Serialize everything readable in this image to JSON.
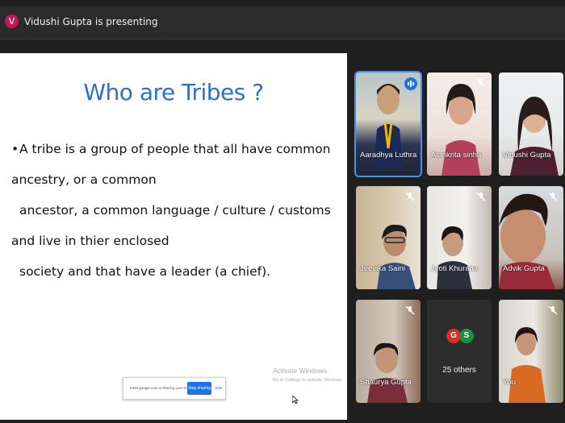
{
  "topbar": {
    "avatar_letter": "V",
    "presenting_text": "Vidushi Gupta is presenting"
  },
  "slide": {
    "title": "Who are Tribes ?",
    "bullet": "•",
    "lines": [
      "A tribe is a group of people that all have common ancestry, or a common",
      "ancestor, a common language / culture / customs and live in thier enclosed",
      "society and that have a leader (a chief)."
    ]
  },
  "share_bar": {
    "message": "meet.google.com is sharing your screen.",
    "stop_label": "Stop sharing",
    "hide_label": "Hide"
  },
  "watermark": {
    "title": "Activate Windows",
    "subtitle": "Go to Settings to activate Windows."
  },
  "participants": [
    {
      "name": "Aaradhya Luthra",
      "state": "speaking"
    },
    {
      "name": "Alankrita sinha",
      "state": "muted"
    },
    {
      "name": "Vidushi Gupta",
      "state": "none"
    },
    {
      "name": "Jeevika Saini",
      "state": "muted"
    },
    {
      "name": "Jyoti Khurana",
      "state": "muted"
    },
    {
      "name": "Advik Gupta",
      "state": "muted"
    },
    {
      "name": "Shaurya Gupta",
      "state": "muted"
    },
    {
      "name": "You",
      "state": "muted"
    }
  ],
  "others": {
    "avatars": [
      {
        "letter": "G",
        "color": "#d93025"
      },
      {
        "letter": "S",
        "color": "#1e8e3e"
      }
    ],
    "label": "25 others"
  },
  "colors": {
    "title_blue": "#2f6fc6",
    "active_outline": "#4a8fe8",
    "stop_button": "#1a73e8"
  }
}
